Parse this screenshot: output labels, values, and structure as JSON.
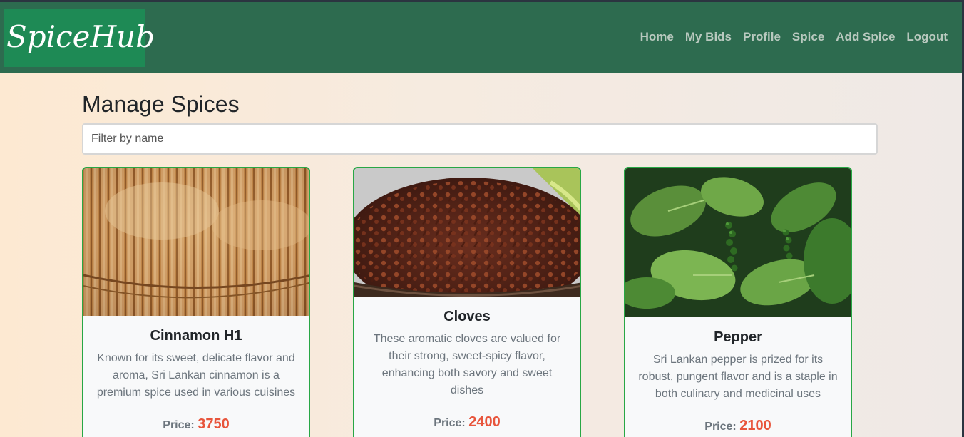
{
  "brand": "SpiceHub",
  "nav": [
    "Home",
    "My Bids",
    "Profile",
    "Spice",
    "Add Spice",
    "Logout"
  ],
  "page_title": "Manage Spices",
  "filter": {
    "placeholder": "Filter by name"
  },
  "cards": [
    {
      "title": "Cinnamon H1",
      "description": "Known for its sweet, delicate flavor and aroma, Sri Lankan cinnamon is a premium spice used in various cuisines",
      "price_label": "Price:",
      "price": "3750",
      "image": "cinnamon-sticks"
    },
    {
      "title": "Cloves",
      "description": "These aromatic cloves are valued for their strong, sweet-spicy flavor, enhancing both savory and sweet dishes",
      "price_label": "Price:",
      "price": "2400",
      "image": "dried-cloves"
    },
    {
      "title": "Pepper",
      "description": "Sri Lankan pepper is prized for its robust, pungent flavor and is a staple in both culinary and medicinal uses",
      "price_label": "Price:",
      "price": "2100",
      "image": "pepper-plant"
    }
  ]
}
